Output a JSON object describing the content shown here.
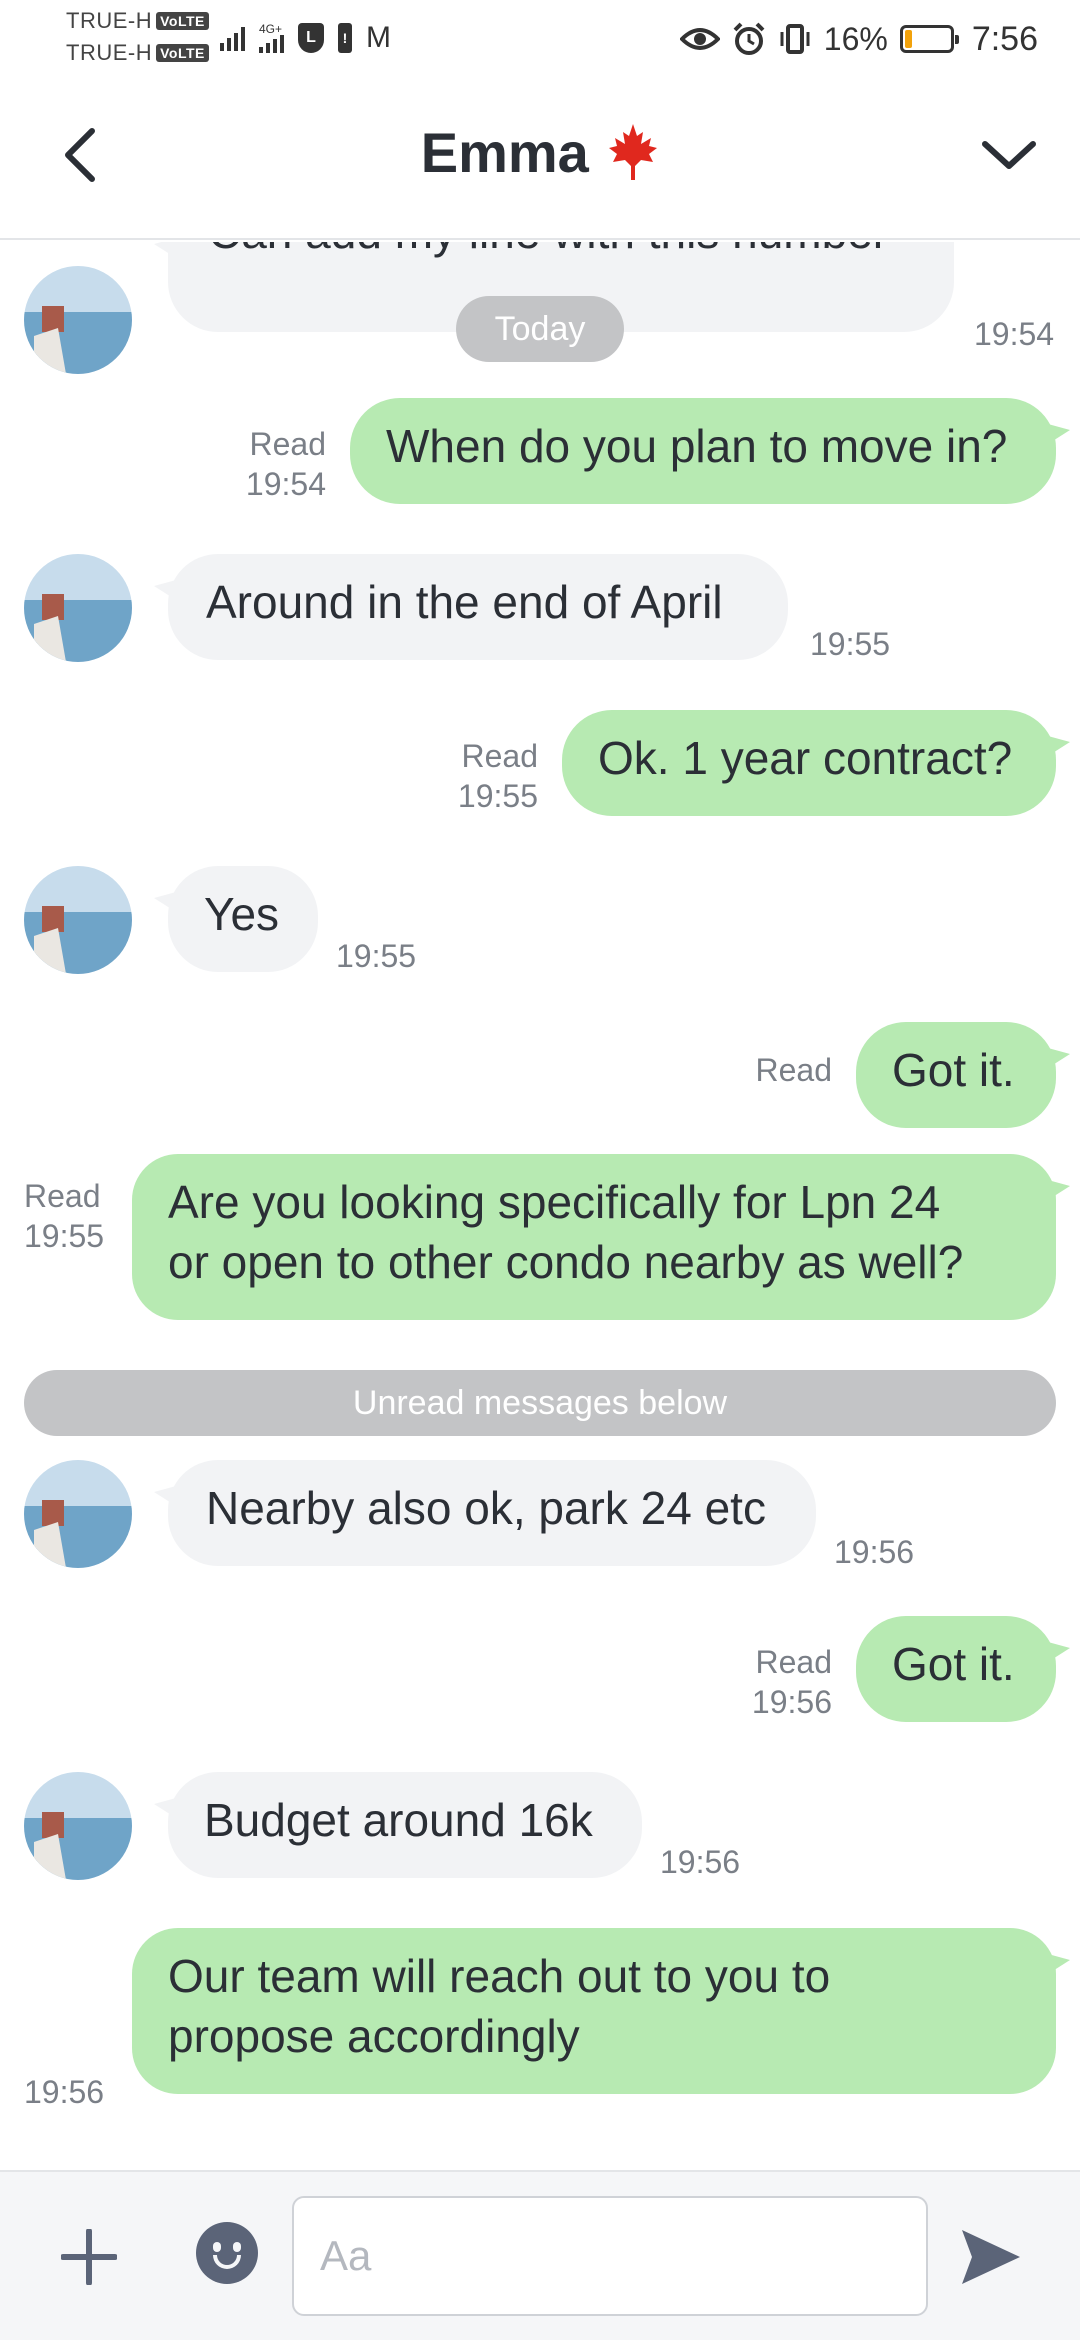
{
  "status_bar": {
    "carrier_1": "TRUE-H",
    "carrier_2": "TRUE-H",
    "volte": "VoLTE",
    "network": "4G+",
    "battery_percent_label": "16%",
    "battery_level": 0.16,
    "time": "7:56"
  },
  "header": {
    "title": "Emma",
    "back_icon": "chevron-left-icon",
    "menu_icon": "chevron-down-icon",
    "flag_icon": "maple-leaf-icon"
  },
  "chat": {
    "partial_message": {
      "text": "Can add my line with this number",
      "time": "19:54"
    },
    "date_separator": "Today",
    "unread_separator": "Unread messages below",
    "messages": [
      {
        "dir": "out",
        "status": "Read",
        "time": "19:54",
        "lines": [
          "When do you plan to move in?"
        ]
      },
      {
        "dir": "in",
        "time": "19:55",
        "lines": [
          "Around in the end of April"
        ]
      },
      {
        "dir": "out",
        "status": "Read",
        "time": "19:55",
        "lines": [
          "Ok. 1 year contract?"
        ]
      },
      {
        "dir": "in",
        "time": "19:55",
        "lines": [
          "Yes"
        ]
      },
      {
        "dir": "out",
        "status": "Read",
        "lines": [
          "Got it."
        ]
      },
      {
        "dir": "out",
        "status": "Read",
        "time": "19:55",
        "lines": [
          "Are you looking specifically for Lpn 24",
          "or open to other condo nearby as well?"
        ]
      },
      {
        "dir": "in",
        "time": "19:56",
        "lines": [
          "Nearby also ok, park 24 etc"
        ]
      },
      {
        "dir": "out",
        "status": "Read",
        "time": "19:56",
        "lines": [
          "Got it."
        ]
      },
      {
        "dir": "in",
        "time": "19:56",
        "lines": [
          "Budget around 16k"
        ]
      },
      {
        "dir": "out",
        "time": "19:56",
        "lines": [
          "Our team will reach out to you to",
          "propose accordingly"
        ]
      }
    ]
  },
  "input_bar": {
    "placeholder": "Aa",
    "plus_icon": "plus-icon",
    "emoji_icon": "emoji-icon",
    "send_icon": "send-icon"
  },
  "colors": {
    "outgoing_bubble": "#b7eab2",
    "incoming_bubble": "#f2f3f5",
    "battery_low": "#f2a20b"
  }
}
